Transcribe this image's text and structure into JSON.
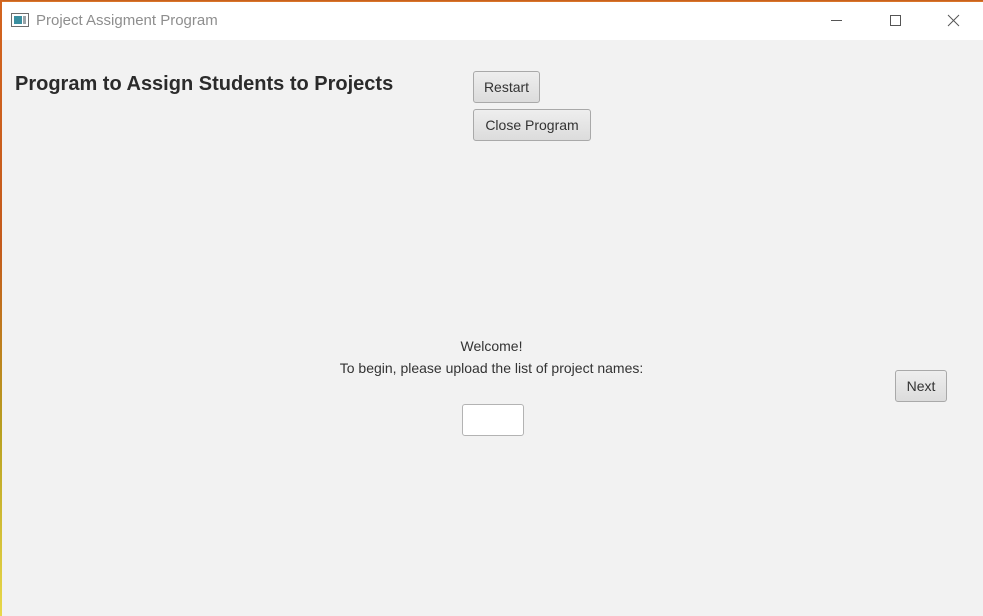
{
  "window": {
    "title": "Project Assigment Program",
    "controls": {
      "minimize": "minimize-icon",
      "maximize": "maximize-icon",
      "close": "close-icon"
    }
  },
  "main": {
    "heading": "Program to Assign Students to Projects",
    "restart_label": "Restart",
    "close_program_label": "Close Program",
    "welcome_line1": "Welcome!",
    "welcome_line2": "To begin, please upload the list of project names:",
    "file_input_value": "",
    "next_label": "Next"
  },
  "colors": {
    "window_background": "#f2f2f2",
    "titlebar_background": "#ffffff",
    "text": "#333333",
    "title_text": "#8e8e8e"
  }
}
